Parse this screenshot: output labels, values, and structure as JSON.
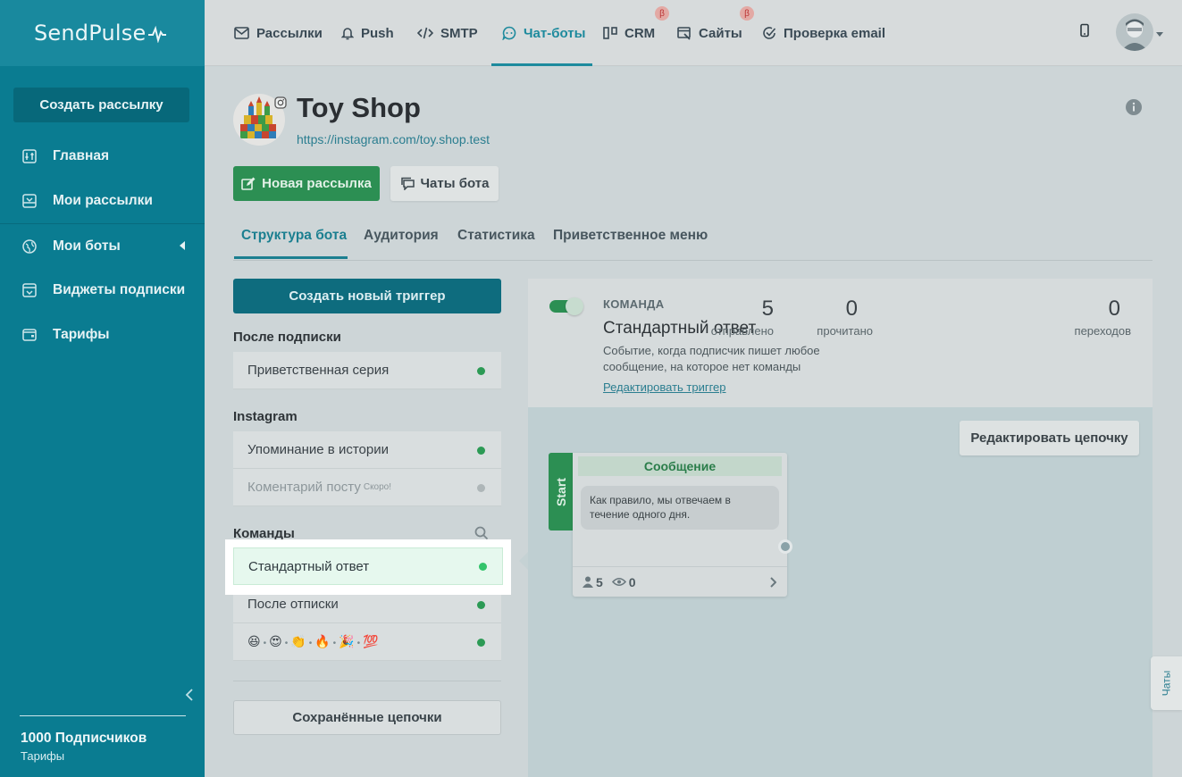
{
  "app": {
    "logo": "SendPulse"
  },
  "sidebar": {
    "create_button": "Создать рассылку",
    "items": [
      {
        "label": "Главная",
        "icon": "sliders-icon"
      },
      {
        "label": "Мои рассылки",
        "icon": "inbox-icon"
      },
      {
        "label": "Мои боты",
        "icon": "globe-icon"
      },
      {
        "label": "Виджеты подписки",
        "icon": "widget-icon"
      },
      {
        "label": "Тарифы",
        "icon": "wallet-icon"
      }
    ],
    "subscribers": "1000 Подписчиков",
    "tariffs_link": "Тарифы"
  },
  "topnav": {
    "items": [
      {
        "label": "Рассылки",
        "icon": "envelope-icon"
      },
      {
        "label": "Push",
        "icon": "bell-icon"
      },
      {
        "label": "SMTP",
        "icon": "code-icon"
      },
      {
        "label": "Чат-боты",
        "icon": "chat-bot-icon"
      },
      {
        "label": "CRM",
        "icon": "crm-icon",
        "beta": "β"
      },
      {
        "label": "Сайты",
        "icon": "site-icon",
        "beta": "β"
      },
      {
        "label": "Проверка email",
        "icon": "check-circle-icon"
      }
    ],
    "active_index": 3
  },
  "bot": {
    "name": "Toy Shop",
    "url": "https://instagram.com/toy.shop.test",
    "new_campaign_button": "Новая рассылка",
    "bot_chats_button": "Чаты бота"
  },
  "tabs": [
    {
      "label": "Структура бота"
    },
    {
      "label": "Аудитория"
    },
    {
      "label": "Статистика"
    },
    {
      "label": "Приветственное меню"
    }
  ],
  "triggers": {
    "create_button": "Создать новый триггер",
    "after_subscribe_title": "После подписки",
    "after_subscribe": [
      {
        "label": "Приветственная серия"
      }
    ],
    "instagram_title": "Instagram",
    "instagram": [
      {
        "label": "Упоминание в истории"
      },
      {
        "label": "Коментарий посту",
        "badge": "Скоро!"
      }
    ],
    "commands_title": "Команды",
    "commands": [
      {
        "label": "Стандартный ответ"
      },
      {
        "label": "После отписки"
      }
    ],
    "emoji_command": [
      "😆",
      "😍",
      "👏",
      "🔥",
      "🎉",
      "💯"
    ],
    "saved_chains_button": "Сохранённые цепочки"
  },
  "panel": {
    "kind": "КОМАНДА",
    "title": "Стандартный ответ",
    "description": "Событие, когда подписчик пишет любое сообщение, на которое нет команды",
    "edit_trigger_link": "Редактировать триггер",
    "stats": [
      {
        "value": "5",
        "label": "отправлено"
      },
      {
        "value": "0",
        "label": "прочитано"
      },
      {
        "value": "0",
        "label": "переходов"
      }
    ],
    "edit_chain_button": "Редактировать цепочку",
    "start_label": "Start",
    "message": {
      "header": "Сообщение",
      "text": "Как правило, мы отвечаем в течение одного дня.",
      "subscribers": "5",
      "views": "0"
    }
  },
  "chats_tab": "Чаты",
  "colors": {
    "brand": "#0a7c91",
    "accent_green": "#2c8f53",
    "active_dot": "#33c46b"
  }
}
